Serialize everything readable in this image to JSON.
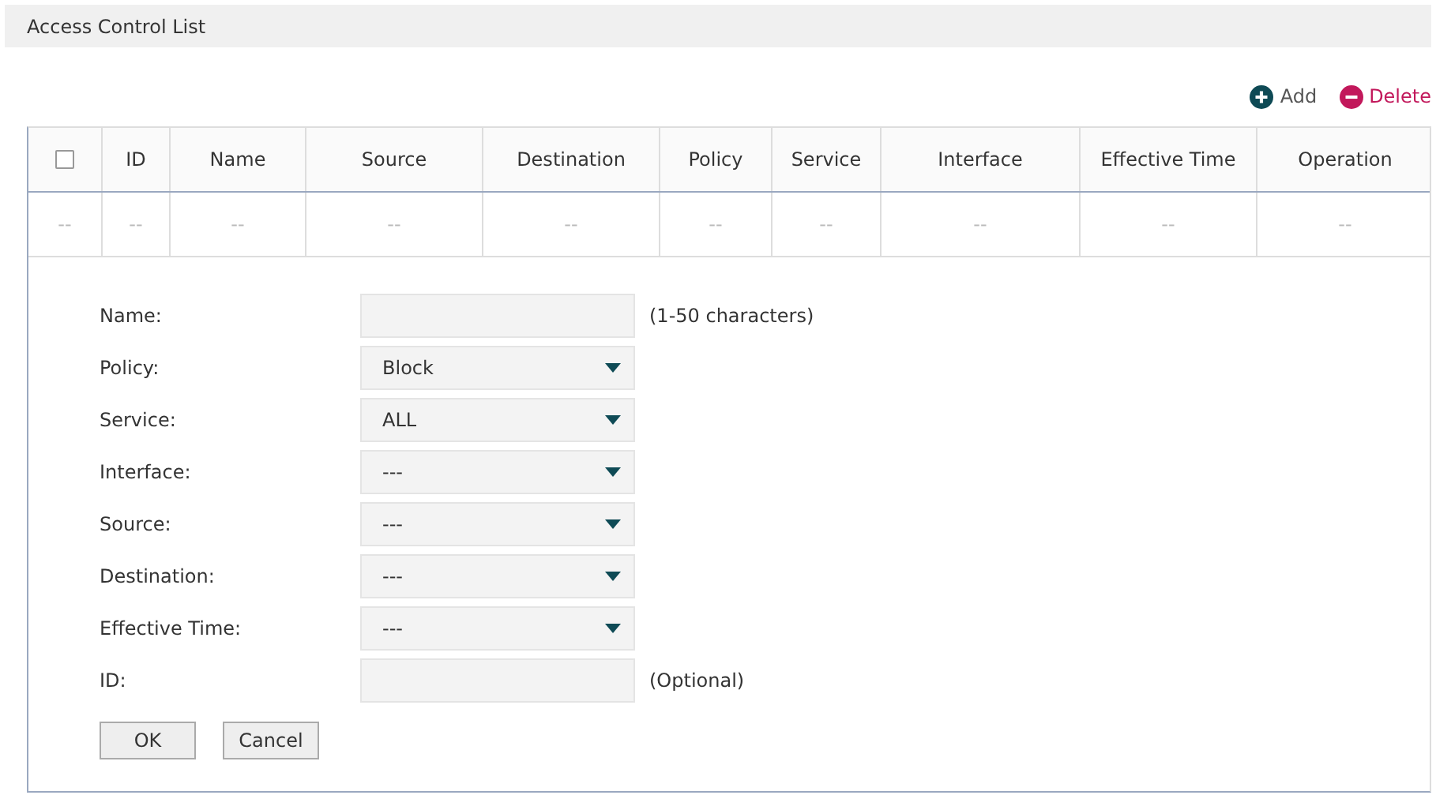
{
  "header": {
    "title": "Access Control List"
  },
  "toolbar": [
    {
      "kind": "add",
      "label": "Add"
    },
    {
      "kind": "delete",
      "label": "Delete"
    }
  ],
  "table": {
    "columns": [
      {
        "kind": "checkbox",
        "checked": false
      },
      {
        "kind": "text",
        "label": "ID"
      },
      {
        "kind": "text",
        "label": "Name"
      },
      {
        "kind": "text",
        "label": "Source"
      },
      {
        "kind": "text",
        "label": "Destination"
      },
      {
        "kind": "text",
        "label": "Policy"
      },
      {
        "kind": "text",
        "label": "Service"
      },
      {
        "kind": "text",
        "label": "Interface"
      },
      {
        "kind": "text",
        "label": "Effective Time"
      },
      {
        "kind": "text",
        "label": "Operation"
      }
    ],
    "rows": [
      {
        "cells": [
          "--",
          "--",
          "--",
          "--",
          "--",
          "--",
          "--",
          "--",
          "--",
          "--"
        ]
      }
    ]
  },
  "form": {
    "fields": [
      {
        "label": "Name:",
        "kind": "text",
        "hint": "(1-50 characters)"
      },
      {
        "label": "Policy:",
        "kind": "select",
        "value": "Block"
      },
      {
        "label": "Service:",
        "kind": "select",
        "value": "ALL"
      },
      {
        "label": "Interface:",
        "kind": "select",
        "value": "---"
      },
      {
        "label": "Source:",
        "kind": "select",
        "value": "---"
      },
      {
        "label": "Destination:",
        "kind": "select",
        "value": "---"
      },
      {
        "label": "Effective Time:",
        "kind": "select",
        "value": "---"
      },
      {
        "label": "ID:",
        "kind": "text",
        "hint": "(Optional)"
      }
    ],
    "buttons": [
      "OK",
      "Cancel"
    ]
  }
}
